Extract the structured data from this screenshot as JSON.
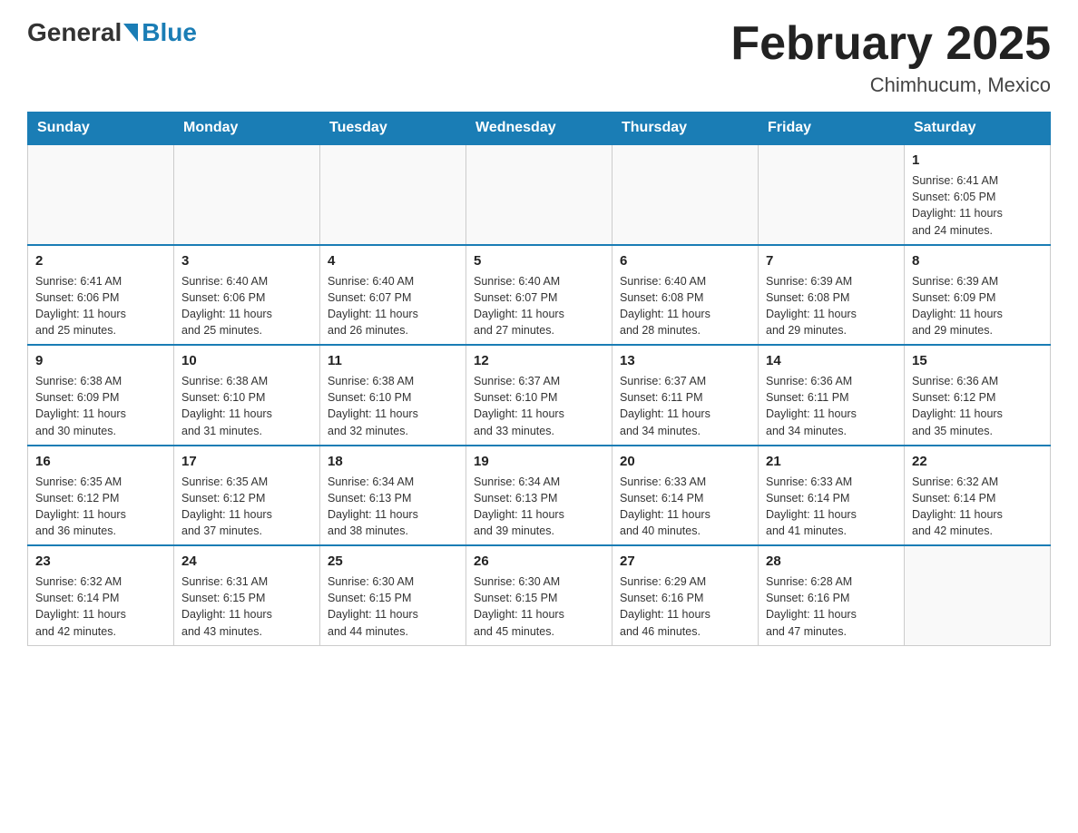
{
  "header": {
    "logo_general": "General",
    "logo_blue": "Blue",
    "month_title": "February 2025",
    "location": "Chimhucum, Mexico"
  },
  "days_of_week": [
    "Sunday",
    "Monday",
    "Tuesday",
    "Wednesday",
    "Thursday",
    "Friday",
    "Saturday"
  ],
  "weeks": [
    [
      {
        "day": "",
        "info": ""
      },
      {
        "day": "",
        "info": ""
      },
      {
        "day": "",
        "info": ""
      },
      {
        "day": "",
        "info": ""
      },
      {
        "day": "",
        "info": ""
      },
      {
        "day": "",
        "info": ""
      },
      {
        "day": "1",
        "info": "Sunrise: 6:41 AM\nSunset: 6:05 PM\nDaylight: 11 hours\nand 24 minutes."
      }
    ],
    [
      {
        "day": "2",
        "info": "Sunrise: 6:41 AM\nSunset: 6:06 PM\nDaylight: 11 hours\nand 25 minutes."
      },
      {
        "day": "3",
        "info": "Sunrise: 6:40 AM\nSunset: 6:06 PM\nDaylight: 11 hours\nand 25 minutes."
      },
      {
        "day": "4",
        "info": "Sunrise: 6:40 AM\nSunset: 6:07 PM\nDaylight: 11 hours\nand 26 minutes."
      },
      {
        "day": "5",
        "info": "Sunrise: 6:40 AM\nSunset: 6:07 PM\nDaylight: 11 hours\nand 27 minutes."
      },
      {
        "day": "6",
        "info": "Sunrise: 6:40 AM\nSunset: 6:08 PM\nDaylight: 11 hours\nand 28 minutes."
      },
      {
        "day": "7",
        "info": "Sunrise: 6:39 AM\nSunset: 6:08 PM\nDaylight: 11 hours\nand 29 minutes."
      },
      {
        "day": "8",
        "info": "Sunrise: 6:39 AM\nSunset: 6:09 PM\nDaylight: 11 hours\nand 29 minutes."
      }
    ],
    [
      {
        "day": "9",
        "info": "Sunrise: 6:38 AM\nSunset: 6:09 PM\nDaylight: 11 hours\nand 30 minutes."
      },
      {
        "day": "10",
        "info": "Sunrise: 6:38 AM\nSunset: 6:10 PM\nDaylight: 11 hours\nand 31 minutes."
      },
      {
        "day": "11",
        "info": "Sunrise: 6:38 AM\nSunset: 6:10 PM\nDaylight: 11 hours\nand 32 minutes."
      },
      {
        "day": "12",
        "info": "Sunrise: 6:37 AM\nSunset: 6:10 PM\nDaylight: 11 hours\nand 33 minutes."
      },
      {
        "day": "13",
        "info": "Sunrise: 6:37 AM\nSunset: 6:11 PM\nDaylight: 11 hours\nand 34 minutes."
      },
      {
        "day": "14",
        "info": "Sunrise: 6:36 AM\nSunset: 6:11 PM\nDaylight: 11 hours\nand 34 minutes."
      },
      {
        "day": "15",
        "info": "Sunrise: 6:36 AM\nSunset: 6:12 PM\nDaylight: 11 hours\nand 35 minutes."
      }
    ],
    [
      {
        "day": "16",
        "info": "Sunrise: 6:35 AM\nSunset: 6:12 PM\nDaylight: 11 hours\nand 36 minutes."
      },
      {
        "day": "17",
        "info": "Sunrise: 6:35 AM\nSunset: 6:12 PM\nDaylight: 11 hours\nand 37 minutes."
      },
      {
        "day": "18",
        "info": "Sunrise: 6:34 AM\nSunset: 6:13 PM\nDaylight: 11 hours\nand 38 minutes."
      },
      {
        "day": "19",
        "info": "Sunrise: 6:34 AM\nSunset: 6:13 PM\nDaylight: 11 hours\nand 39 minutes."
      },
      {
        "day": "20",
        "info": "Sunrise: 6:33 AM\nSunset: 6:14 PM\nDaylight: 11 hours\nand 40 minutes."
      },
      {
        "day": "21",
        "info": "Sunrise: 6:33 AM\nSunset: 6:14 PM\nDaylight: 11 hours\nand 41 minutes."
      },
      {
        "day": "22",
        "info": "Sunrise: 6:32 AM\nSunset: 6:14 PM\nDaylight: 11 hours\nand 42 minutes."
      }
    ],
    [
      {
        "day": "23",
        "info": "Sunrise: 6:32 AM\nSunset: 6:14 PM\nDaylight: 11 hours\nand 42 minutes."
      },
      {
        "day": "24",
        "info": "Sunrise: 6:31 AM\nSunset: 6:15 PM\nDaylight: 11 hours\nand 43 minutes."
      },
      {
        "day": "25",
        "info": "Sunrise: 6:30 AM\nSunset: 6:15 PM\nDaylight: 11 hours\nand 44 minutes."
      },
      {
        "day": "26",
        "info": "Sunrise: 6:30 AM\nSunset: 6:15 PM\nDaylight: 11 hours\nand 45 minutes."
      },
      {
        "day": "27",
        "info": "Sunrise: 6:29 AM\nSunset: 6:16 PM\nDaylight: 11 hours\nand 46 minutes."
      },
      {
        "day": "28",
        "info": "Sunrise: 6:28 AM\nSunset: 6:16 PM\nDaylight: 11 hours\nand 47 minutes."
      },
      {
        "day": "",
        "info": ""
      }
    ]
  ]
}
